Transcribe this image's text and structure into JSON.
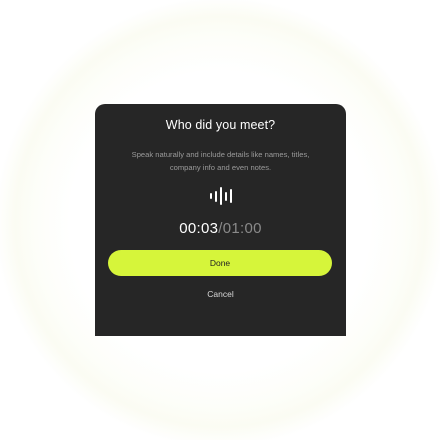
{
  "dialog": {
    "title": "Who did you meet?",
    "subtitle_line1": "Speak naturally and include details like names, titles,",
    "subtitle_line2": "company info and even notes.",
    "timer": {
      "elapsed": "00:03",
      "separator": "/",
      "total": "01:00"
    },
    "done_label": "Done",
    "cancel_label": "Cancel",
    "recording_icon": "audio-waveform-icon"
  },
  "colors": {
    "dialog_background": "#262626",
    "accent": "#d6f53a",
    "muted_text": "#8a8a8a"
  }
}
